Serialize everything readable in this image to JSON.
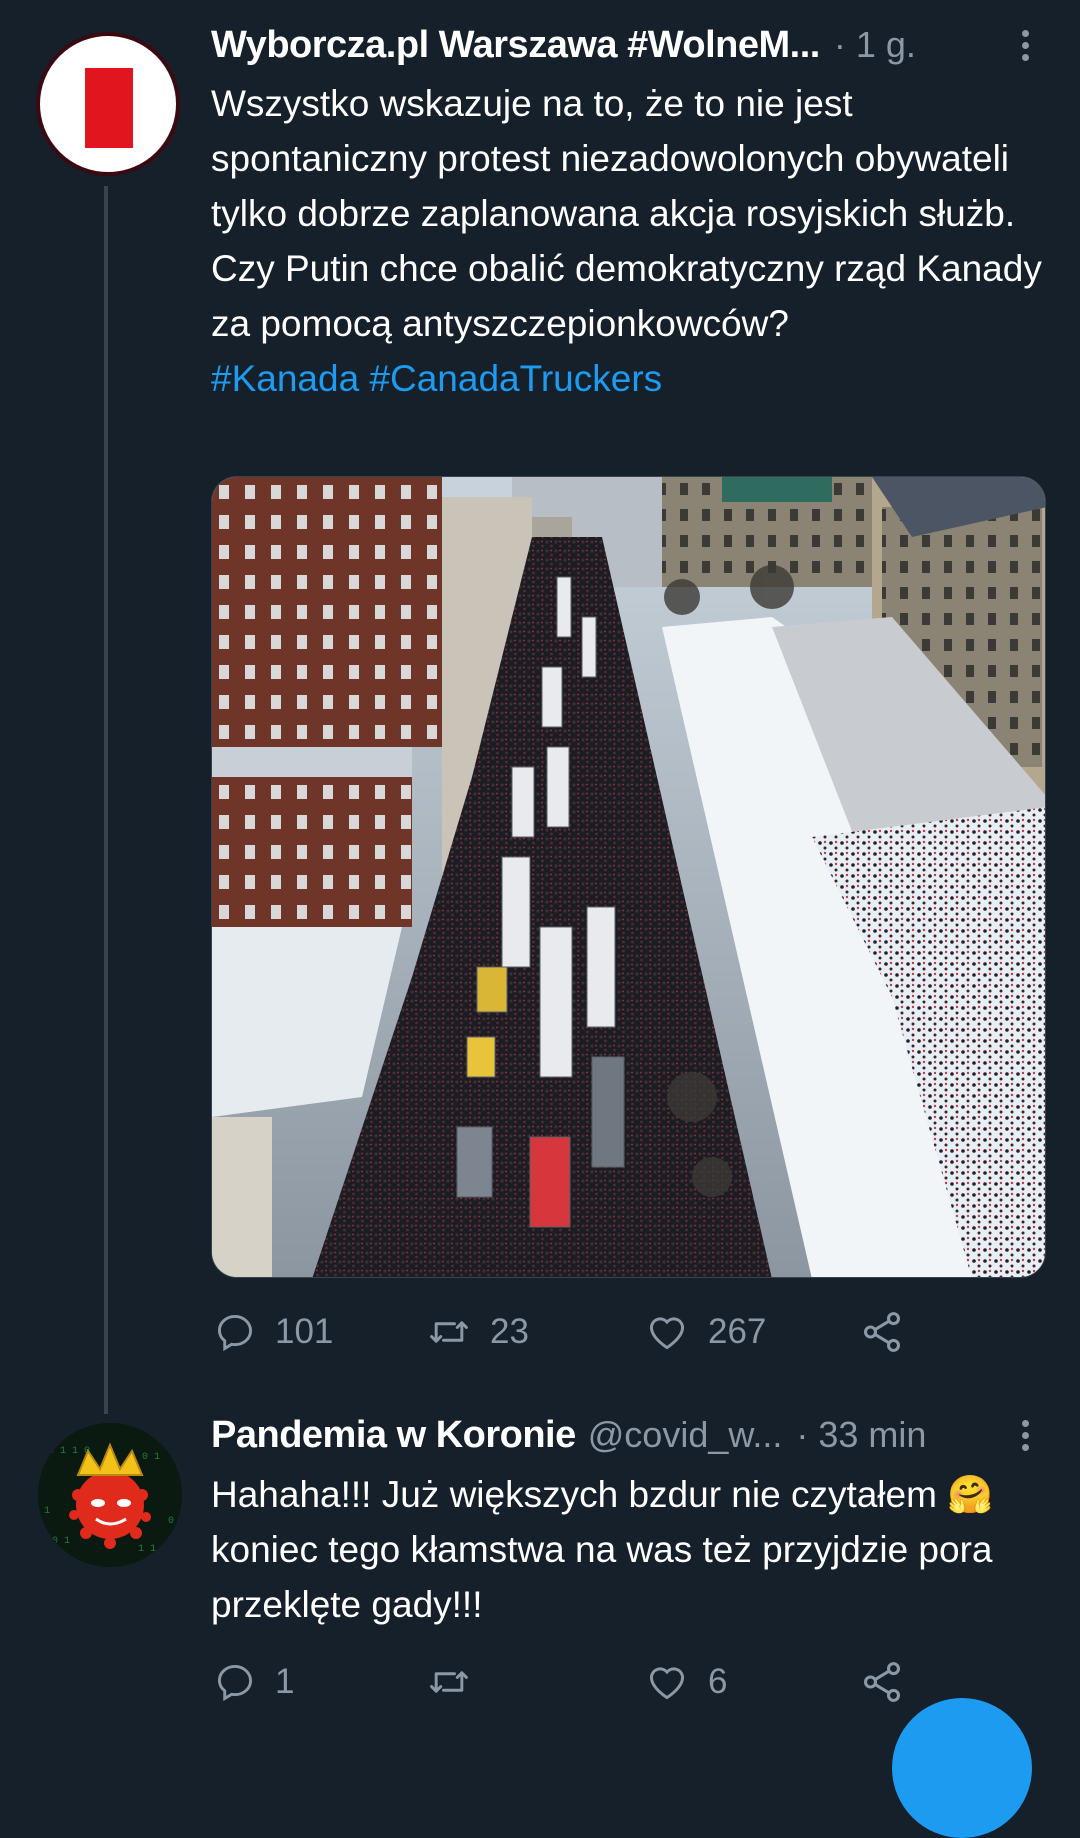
{
  "tweets": [
    {
      "author_name": "Wyborcza.pl Warszawa #WolneM...",
      "time": "· 1 g.",
      "text": "Wszystko wskazuje na to, że to nie jest spontaniczny protest niezadowolonych obywateli tylko dobrze zaplanowana akcja rosyjskich służb. Czy Putin chce obalić demokratyczny rząd Kanady za pomocą antyszczepionkowców?",
      "hashtags": "#Kanada #CanadaTruckers",
      "stats": {
        "replies": "101",
        "retweets": "23",
        "likes": "267"
      }
    },
    {
      "author_name": "Pandemia w Koronie",
      "handle": "@covid_w...",
      "time": "· 33 min",
      "text": "Hahaha!!! Już większych bzdur nie czytałem 🤗 koniec tego kłamstwa na was też przyjdzie pora przeklęte gady!!!",
      "stats": {
        "replies": "1",
        "likes": "6"
      }
    }
  ],
  "colors": {
    "background": "#15202b",
    "text": "#ffffff",
    "secondary": "#8b98a5",
    "link": "#1d9bf0",
    "accent_red": "#e0151d"
  },
  "icons": [
    "reply-icon",
    "retweet-icon",
    "like-icon",
    "share-icon",
    "more-icon"
  ]
}
